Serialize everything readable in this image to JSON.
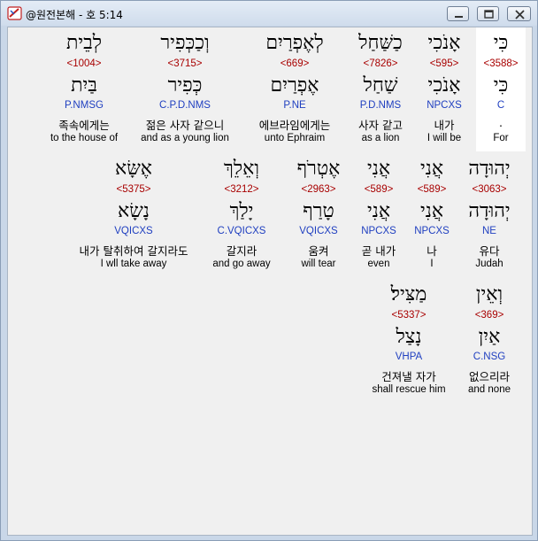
{
  "window": {
    "title": "@원전본해 - 호 5:14"
  },
  "words": [
    {
      "hebrew": "כִּי",
      "strong": "<3588>",
      "lemma": "כִּי",
      "morph": "C",
      "korean": ".",
      "english": "For"
    },
    {
      "hebrew": "אָנֹכִי",
      "strong": "<595>",
      "lemma": "אָנֹכִי",
      "morph": "NPCXS",
      "korean": "내가",
      "english": "I will be"
    },
    {
      "hebrew": "כַשַּׁחַל",
      "strong": "<7826>",
      "lemma": "שַׁחַל",
      "morph": "P.D.NMS",
      "korean": "사자 같고",
      "english": "as a lion"
    },
    {
      "hebrew": "לְאֶפְרַיִם",
      "strong": "<669>",
      "lemma": "אֶפְרַיִם",
      "morph": "P.NE",
      "korean": "에브라임에게는",
      "english": "unto Ephraim"
    },
    {
      "hebrew": "וְכַכְּפִיר",
      "strong": "<3715>",
      "lemma": "כְּפִיר",
      "morph": "C.P.D.NMS",
      "korean": "젊은 사자 같으니",
      "english": "and as a young lion"
    },
    {
      "hebrew": "לְבֵית",
      "strong": "<1004>",
      "lemma": "בַּיִת",
      "morph": "P.NMSG",
      "korean": "족속에게는",
      "english": "to the house of"
    },
    {
      "hebrew": "יְהוּדָה",
      "strong": "<3063>",
      "lemma": "יְהוּדָה",
      "morph": "NE",
      "korean": "유다",
      "english": "Judah"
    },
    {
      "hebrew": "אֲנִי",
      "strong": "<589>",
      "lemma": "אֲנִי",
      "morph": "NPCXS",
      "korean": "나",
      "english": "I"
    },
    {
      "hebrew": "אֲנִי",
      "strong": "<589>",
      "lemma": "אֲנִי",
      "morph": "NPCXS",
      "korean": "곧 내가",
      "english": "even"
    },
    {
      "hebrew": "אֶטְרֹף",
      "strong": "<2963>",
      "lemma": "טָרַף",
      "morph": "VQICXS",
      "korean": "움켜",
      "english": "will tear"
    },
    {
      "hebrew": "וְאֵלֵךְ",
      "strong": "<3212>",
      "lemma": "יָלַךְ",
      "morph": "C.VQICXS",
      "korean": "갈지라",
      "english": "and go away"
    },
    {
      "hebrew": "אֶשָּׂא",
      "strong": "<5375>",
      "lemma": "נָשָׂא",
      "morph": "VQICXS",
      "korean": "내가 탈취하여 갈지라도",
      "english": "I wll take away"
    },
    {
      "hebrew": "וְאֵין",
      "strong": "<369>",
      "lemma": "אַיִן",
      "morph": "C.NSG",
      "korean": "없으리라",
      "english": "and none"
    },
    {
      "hebrew": "מַצִּיל׃",
      "strong": "<5337>",
      "lemma": "נָצַל",
      "morph": "VHPA",
      "korean": "건져낼 자가",
      "english": "shall rescue him"
    }
  ]
}
